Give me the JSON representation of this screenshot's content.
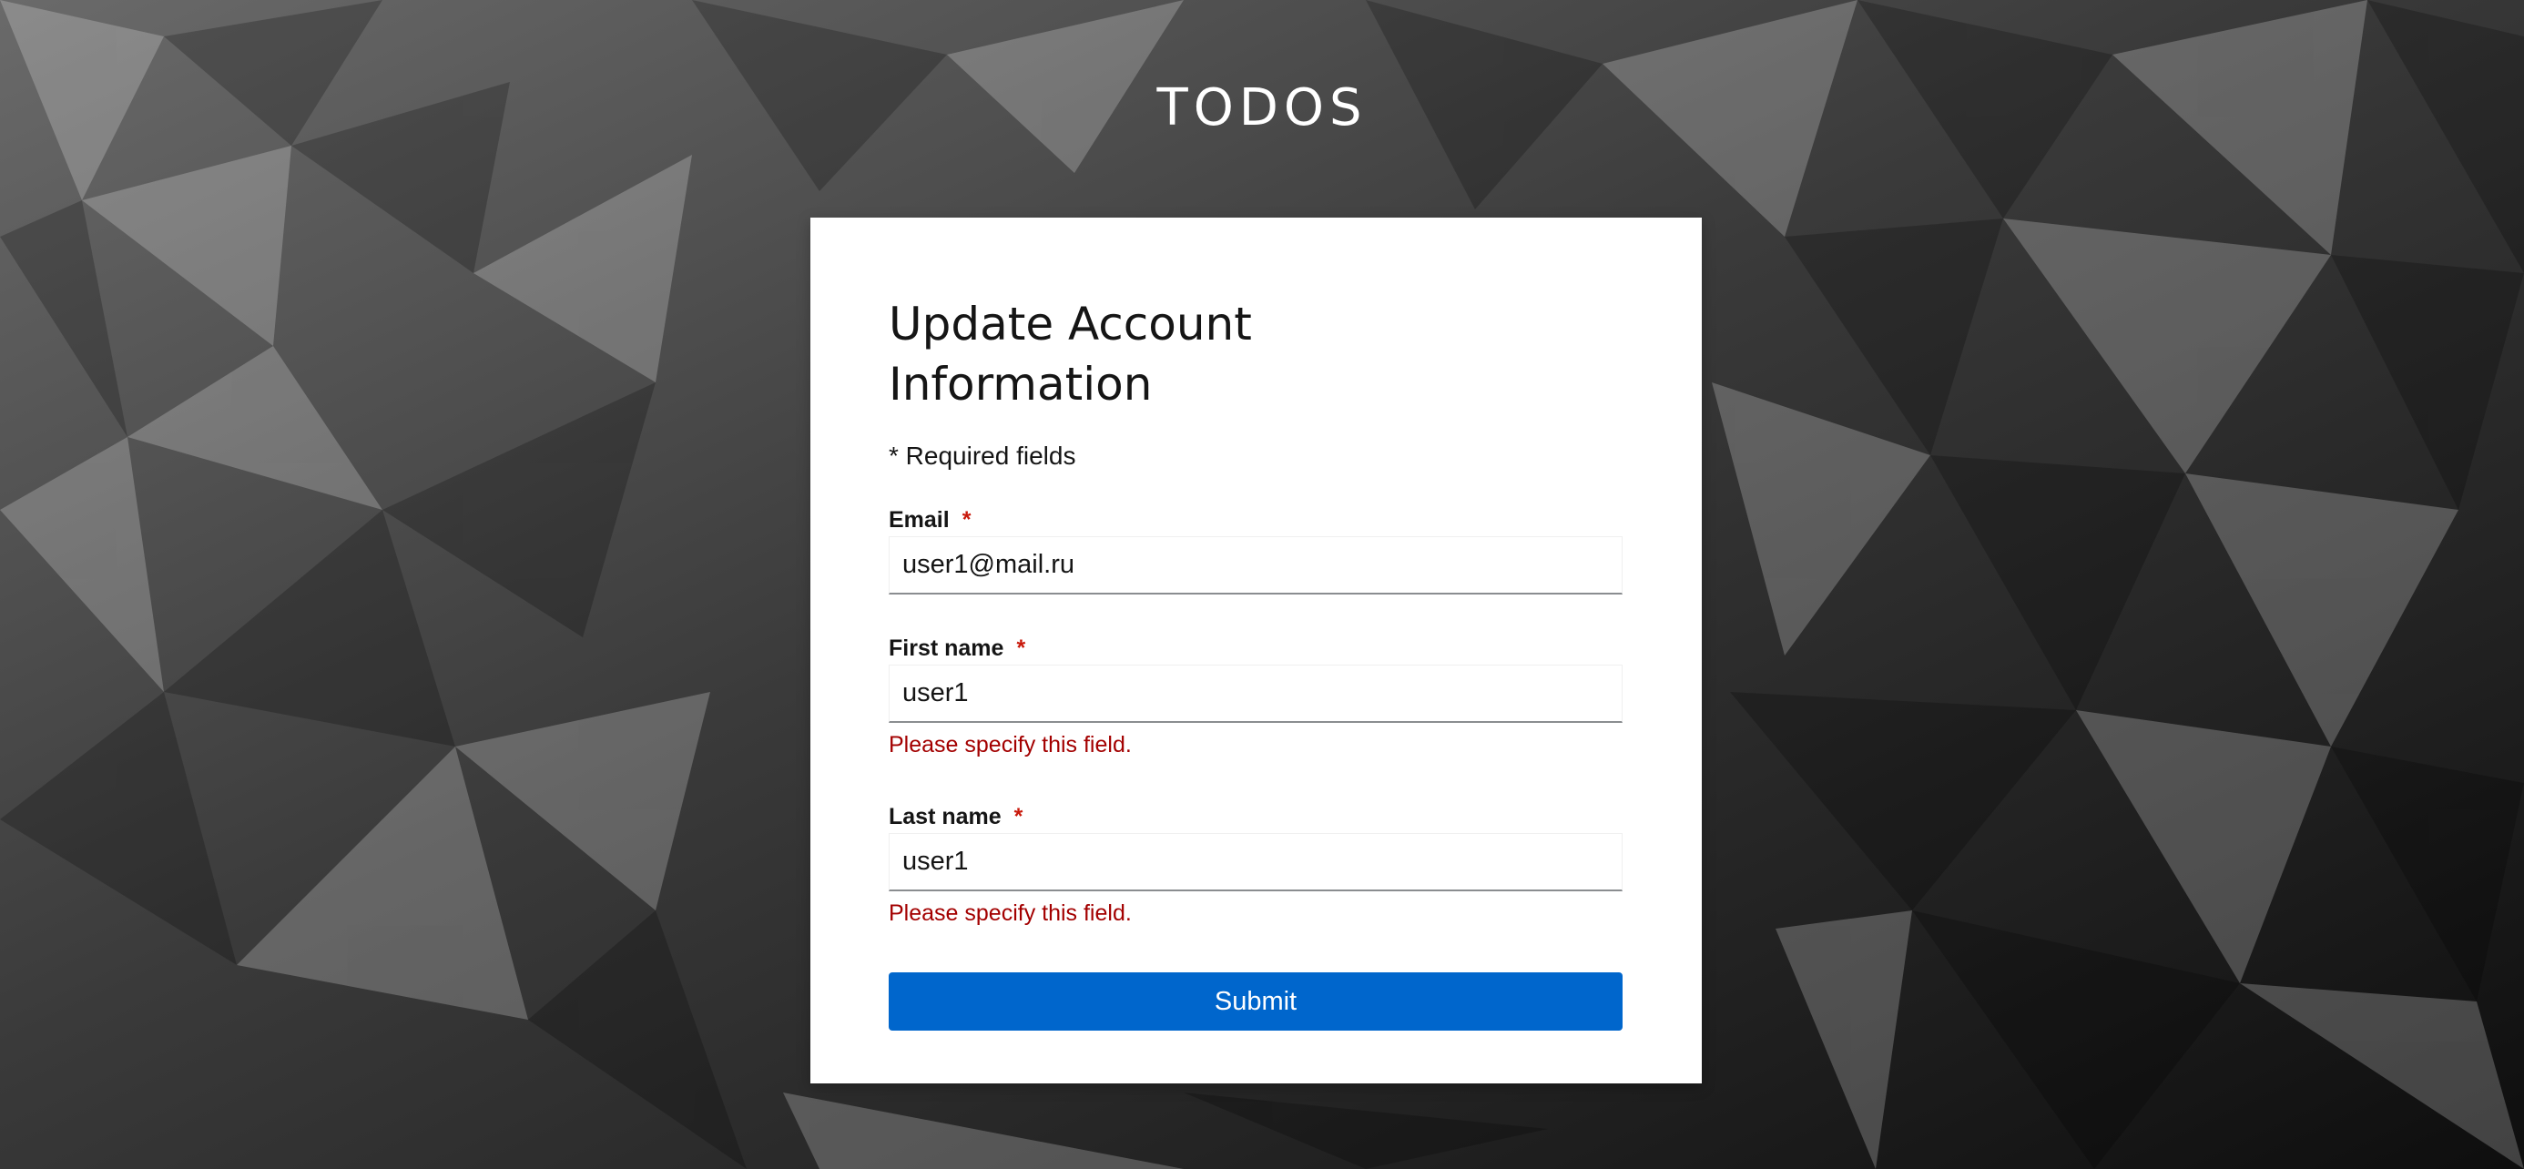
{
  "brand": "TODOS",
  "title": "Update Account Information",
  "required_note": "* Required fields",
  "required_marker": "*",
  "fields": {
    "email": {
      "label": "Email",
      "value": "user1@mail.ru"
    },
    "first_name": {
      "label": "First name",
      "value": "user1",
      "error": "Please specify this field."
    },
    "last_name": {
      "label": "Last name",
      "value": "user1",
      "error": "Please specify this field."
    }
  },
  "submit_label": "Submit",
  "colors": {
    "primary": "#0066cc",
    "error": "#a30000",
    "required_star": "#c9190b"
  }
}
